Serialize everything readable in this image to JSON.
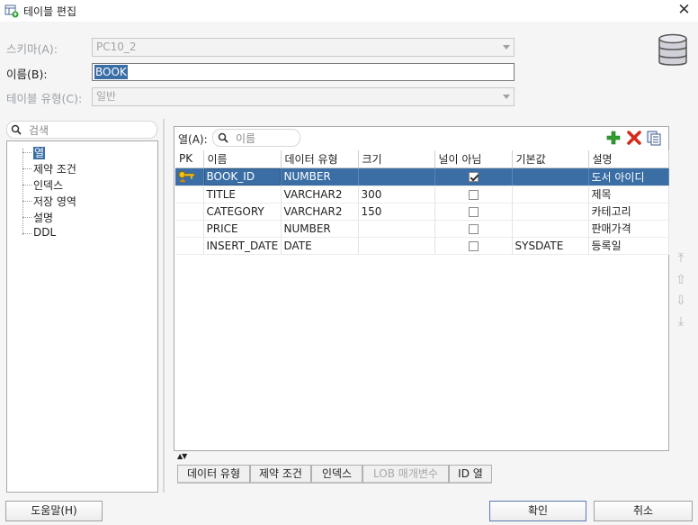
{
  "window": {
    "title": "테이블 편집",
    "close_glyph": "✕"
  },
  "form": {
    "schema_label": "스키마(A):",
    "schema_value": "PC10_2",
    "name_label": "이름(B):",
    "name_value": "BOOK",
    "table_type_label": "테이블 유형(C):",
    "table_type_value": "일반"
  },
  "left": {
    "search_placeholder": "검색",
    "items": [
      "열",
      "제약 조건",
      "인덱스",
      "저장 영역",
      "설명",
      "DDL"
    ]
  },
  "columns_panel": {
    "label": "열(A):",
    "search_placeholder": "이름",
    "headers": [
      "PK",
      "이름",
      "데이터 유형",
      "크기",
      "널이 아님",
      "기본값",
      "설명"
    ],
    "rows": [
      {
        "pk": true,
        "name": "BOOK_ID",
        "type": "NUMBER",
        "size": "",
        "not_null": true,
        "default": "",
        "desc": "도서 아이디"
      },
      {
        "pk": false,
        "name": "TITLE",
        "type": "VARCHAR2",
        "size": "300",
        "not_null": false,
        "default": "",
        "desc": "제목"
      },
      {
        "pk": false,
        "name": "CATEGORY",
        "type": "VARCHAR2",
        "size": "150",
        "not_null": false,
        "default": "",
        "desc": "카테고리"
      },
      {
        "pk": false,
        "name": "PRICE",
        "type": "NUMBER",
        "size": "",
        "not_null": false,
        "default": "",
        "desc": "판매가격"
      },
      {
        "pk": false,
        "name": "INSERT_DATE",
        "type": "DATE",
        "size": "",
        "not_null": false,
        "default": "SYSDATE",
        "desc": "등록일"
      }
    ],
    "tabs": [
      "데이터 유형",
      "제약 조건",
      "인덱스",
      "LOB 매개변수",
      "ID 열"
    ]
  },
  "buttons": {
    "help": "도움말(H)",
    "ok": "확인",
    "cancel": "취소"
  },
  "colors": {
    "selection": "#3a6ea5",
    "add": "#2e9e2e",
    "delete": "#d42a1a"
  }
}
